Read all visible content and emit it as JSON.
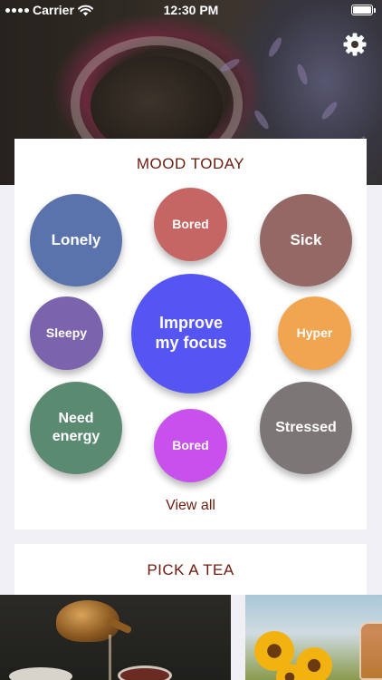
{
  "status_bar": {
    "carrier": "Carrier",
    "time": "12:30 PM"
  },
  "mood_section": {
    "title": "MOOD TODAY",
    "view_all": "View all",
    "moods": [
      {
        "label": "Lonely",
        "color": "#5b73ad"
      },
      {
        "label": "Bored",
        "color": "#c56664"
      },
      {
        "label": "Sick",
        "color": "#946865"
      },
      {
        "label": "Sleepy",
        "color": "#7b63ad"
      },
      {
        "label": "Improve my focus",
        "color": "#5555f3"
      },
      {
        "label": "Hyper",
        "color": "#f2a551"
      },
      {
        "label": "Need energy",
        "color": "#5b8a73"
      },
      {
        "label": "Bored",
        "color": "#c851ee"
      },
      {
        "label": "Stressed",
        "color": "#7d7676"
      }
    ]
  },
  "tea_section": {
    "title": "PICK A TEA"
  },
  "colors": {
    "accent_text": "#6b1c0e",
    "background": "#efeff4",
    "card": "#ffffff"
  },
  "icons": {
    "settings": "gear-icon",
    "signal": "signal-icon",
    "wifi": "wifi-icon",
    "battery": "battery-icon"
  }
}
